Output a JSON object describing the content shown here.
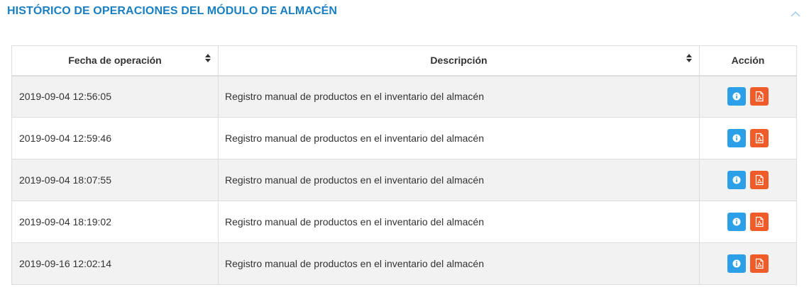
{
  "panel": {
    "title": "HISTÓRICO DE OPERACIONES DEL MÓDULO DE ALMACÉN",
    "collapse_icon": "chevron-up-icon"
  },
  "table": {
    "columns": [
      {
        "label": "Fecha de operación",
        "sortable": true
      },
      {
        "label": "Descripción",
        "sortable": true
      },
      {
        "label": "Acción",
        "sortable": false
      }
    ],
    "rows": [
      {
        "fecha": "2019-09-04 12:56:05",
        "descripcion": "Registro manual de productos en el inventario del almacén"
      },
      {
        "fecha": "2019-09-04 12:59:46",
        "descripcion": "Registro manual de productos en el inventario del almacén"
      },
      {
        "fecha": "2019-09-04 18:07:55",
        "descripcion": "Registro manual de productos en el inventario del almacén"
      },
      {
        "fecha": "2019-09-04 18:19:02",
        "descripcion": "Registro manual de productos en el inventario del almacén"
      },
      {
        "fecha": "2019-09-16 12:02:14",
        "descripcion": "Registro manual de productos en el inventario del almacén"
      }
    ],
    "row_actions": [
      {
        "name": "info-button",
        "icon": "info-circle-icon",
        "color": "#2ba0e8"
      },
      {
        "name": "pdf-button",
        "icon": "file-pdf-icon",
        "color": "#f05b2a"
      }
    ]
  },
  "colors": {
    "title": "#1a7fc1",
    "stripe": "#f2f2f2",
    "border": "#dddddd"
  }
}
